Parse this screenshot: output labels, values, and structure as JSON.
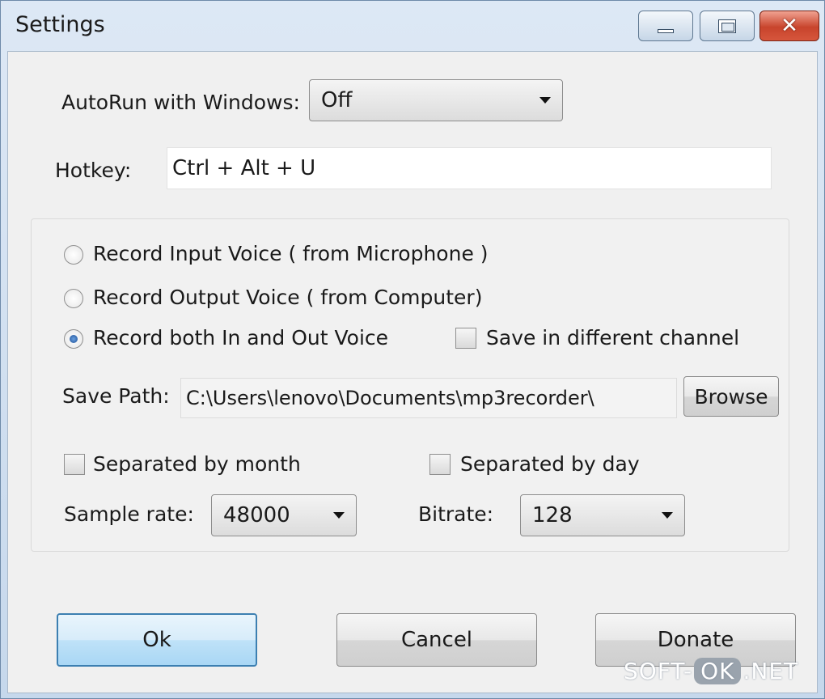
{
  "window": {
    "title": "Settings",
    "minimize_icon": "minimize-icon",
    "maximize_icon": "maximize-icon",
    "close_icon": "close-icon",
    "close_glyph": "✕"
  },
  "autorun": {
    "label": "AutoRun with Windows:",
    "value": "Off"
  },
  "hotkey": {
    "label": "Hotkey:",
    "value": "Ctrl + Alt + U"
  },
  "record": {
    "options": [
      {
        "label": "Record Input Voice ( from Microphone )",
        "checked": false
      },
      {
        "label": "Record Output Voice ( from Computer)",
        "checked": false
      },
      {
        "label": "Record both In and Out Voice",
        "checked": true
      }
    ],
    "save_channel": {
      "label": "Save in different channel",
      "checked": false
    }
  },
  "save_path": {
    "label": "Save Path:",
    "value": "C:\\Users\\lenovo\\Documents\\mp3recorder\\",
    "browse_label": "Browse"
  },
  "separation": {
    "by_month": {
      "label": "Separated by month",
      "checked": false
    },
    "by_day": {
      "label": "Separated by day",
      "checked": false
    }
  },
  "sample_rate": {
    "label": "Sample rate:",
    "value": "48000"
  },
  "bitrate": {
    "label": "Bitrate:",
    "value": "128"
  },
  "buttons": {
    "ok": "Ok",
    "cancel": "Cancel",
    "donate": "Donate"
  },
  "watermark": {
    "left": "SOFT-",
    "mid": "OK",
    "right": ".NET"
  },
  "colors": {
    "accent": "#3c7fb1",
    "close_red": "#c8442c"
  }
}
